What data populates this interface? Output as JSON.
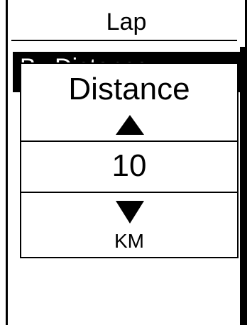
{
  "header": {
    "title": "Lap"
  },
  "list": {
    "selected_item_label": "By Distance"
  },
  "dialog": {
    "title": "Distance",
    "value": "10",
    "unit": "KM",
    "up_icon": "triangle-up",
    "down_icon": "triangle-down"
  },
  "colors": {
    "background": "#ffffff",
    "foreground": "#000000"
  }
}
